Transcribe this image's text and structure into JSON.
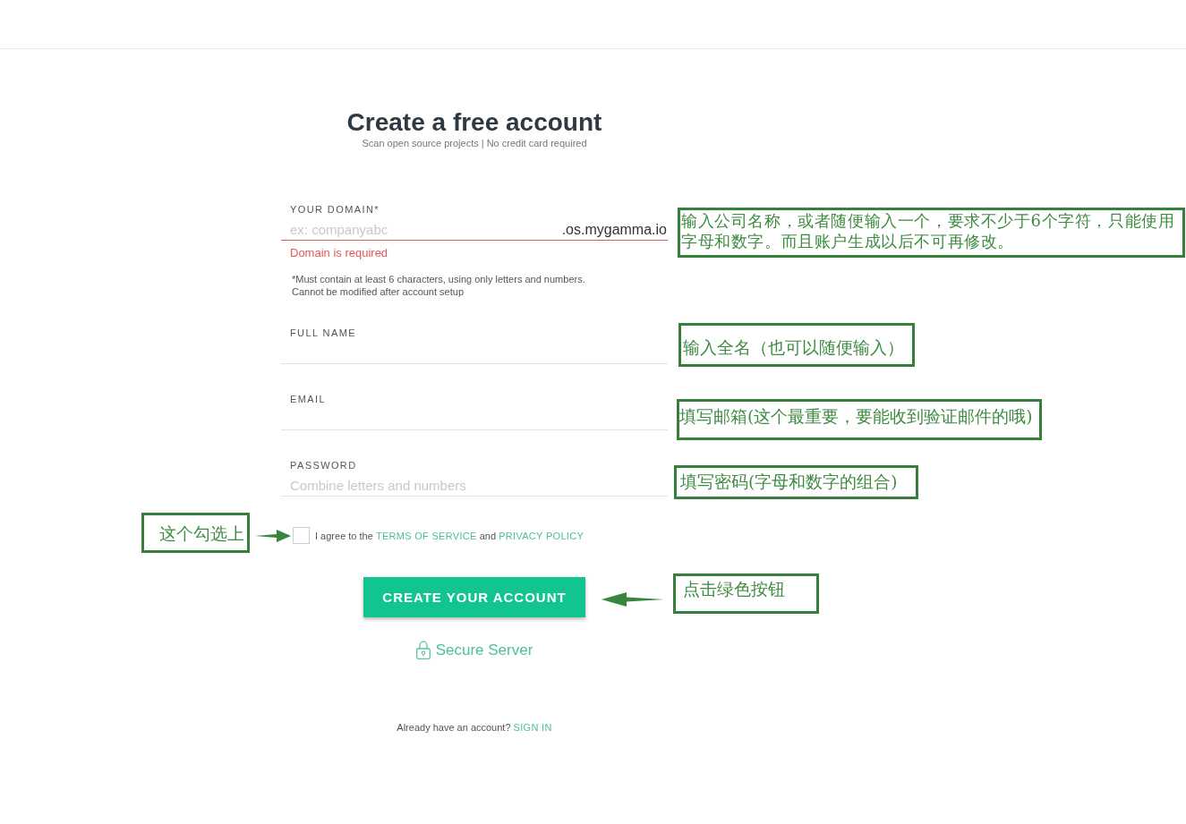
{
  "form": {
    "title": "Create a free account",
    "subtitle": "Scan open source projects | No credit card required",
    "fields": [
      {
        "label": "YOUR DOMAIN*",
        "placeholder": "ex: companyabc",
        "suffix": ".os.mygamma.io",
        "invalid": true,
        "error": "Domain is required",
        "notes": [
          "*Must contain at least 6 characters, using only letters and numbers.",
          "Cannot be modified after account setup"
        ]
      },
      {
        "label": "FULL NAME",
        "invalid": false
      },
      {
        "label": "EMAIL",
        "invalid": false
      },
      {
        "label": "PASSWORD",
        "placeholder": "Combine letters and numbers",
        "invalid": false
      }
    ],
    "agreement": {
      "checked": false,
      "parts": [
        {
          "kind": "text",
          "text": "I agree to the"
        },
        {
          "kind": "link",
          "text": "TERMS OF SERVICE"
        },
        {
          "kind": "text",
          "text": "and"
        },
        {
          "kind": "link",
          "text": "PRIVACY POLICY"
        }
      ]
    },
    "submit_button": {
      "label": "CREATE YOUR ACCOUNT"
    },
    "secure_note": {
      "text": "Secure Server"
    },
    "sign_in": {
      "parts": [
        {
          "kind": "text",
          "text": "Already have an account?"
        },
        {
          "kind": "link",
          "text": "SIGN IN"
        }
      ]
    }
  },
  "annotations": [
    {
      "kind": "plain",
      "text": "输入公司名称，或者随便输入一个，要求不少于6个字符，只能使用字母和数字。而且账户生成以后不可再修改。"
    },
    {
      "kind": "plain",
      "text": "输入全名（也可以随便输入）"
    },
    {
      "kind": "plain",
      "text": "填写邮箱(这个最重要，要能收到验证邮件的哦)"
    },
    {
      "kind": "plain",
      "text": "填写密码(字母和数字的组合)"
    },
    {
      "kind": "arrow-right",
      "text": "这个勾选上"
    },
    {
      "kind": "arrow-left",
      "text": "点击绿色按钮"
    }
  ]
}
